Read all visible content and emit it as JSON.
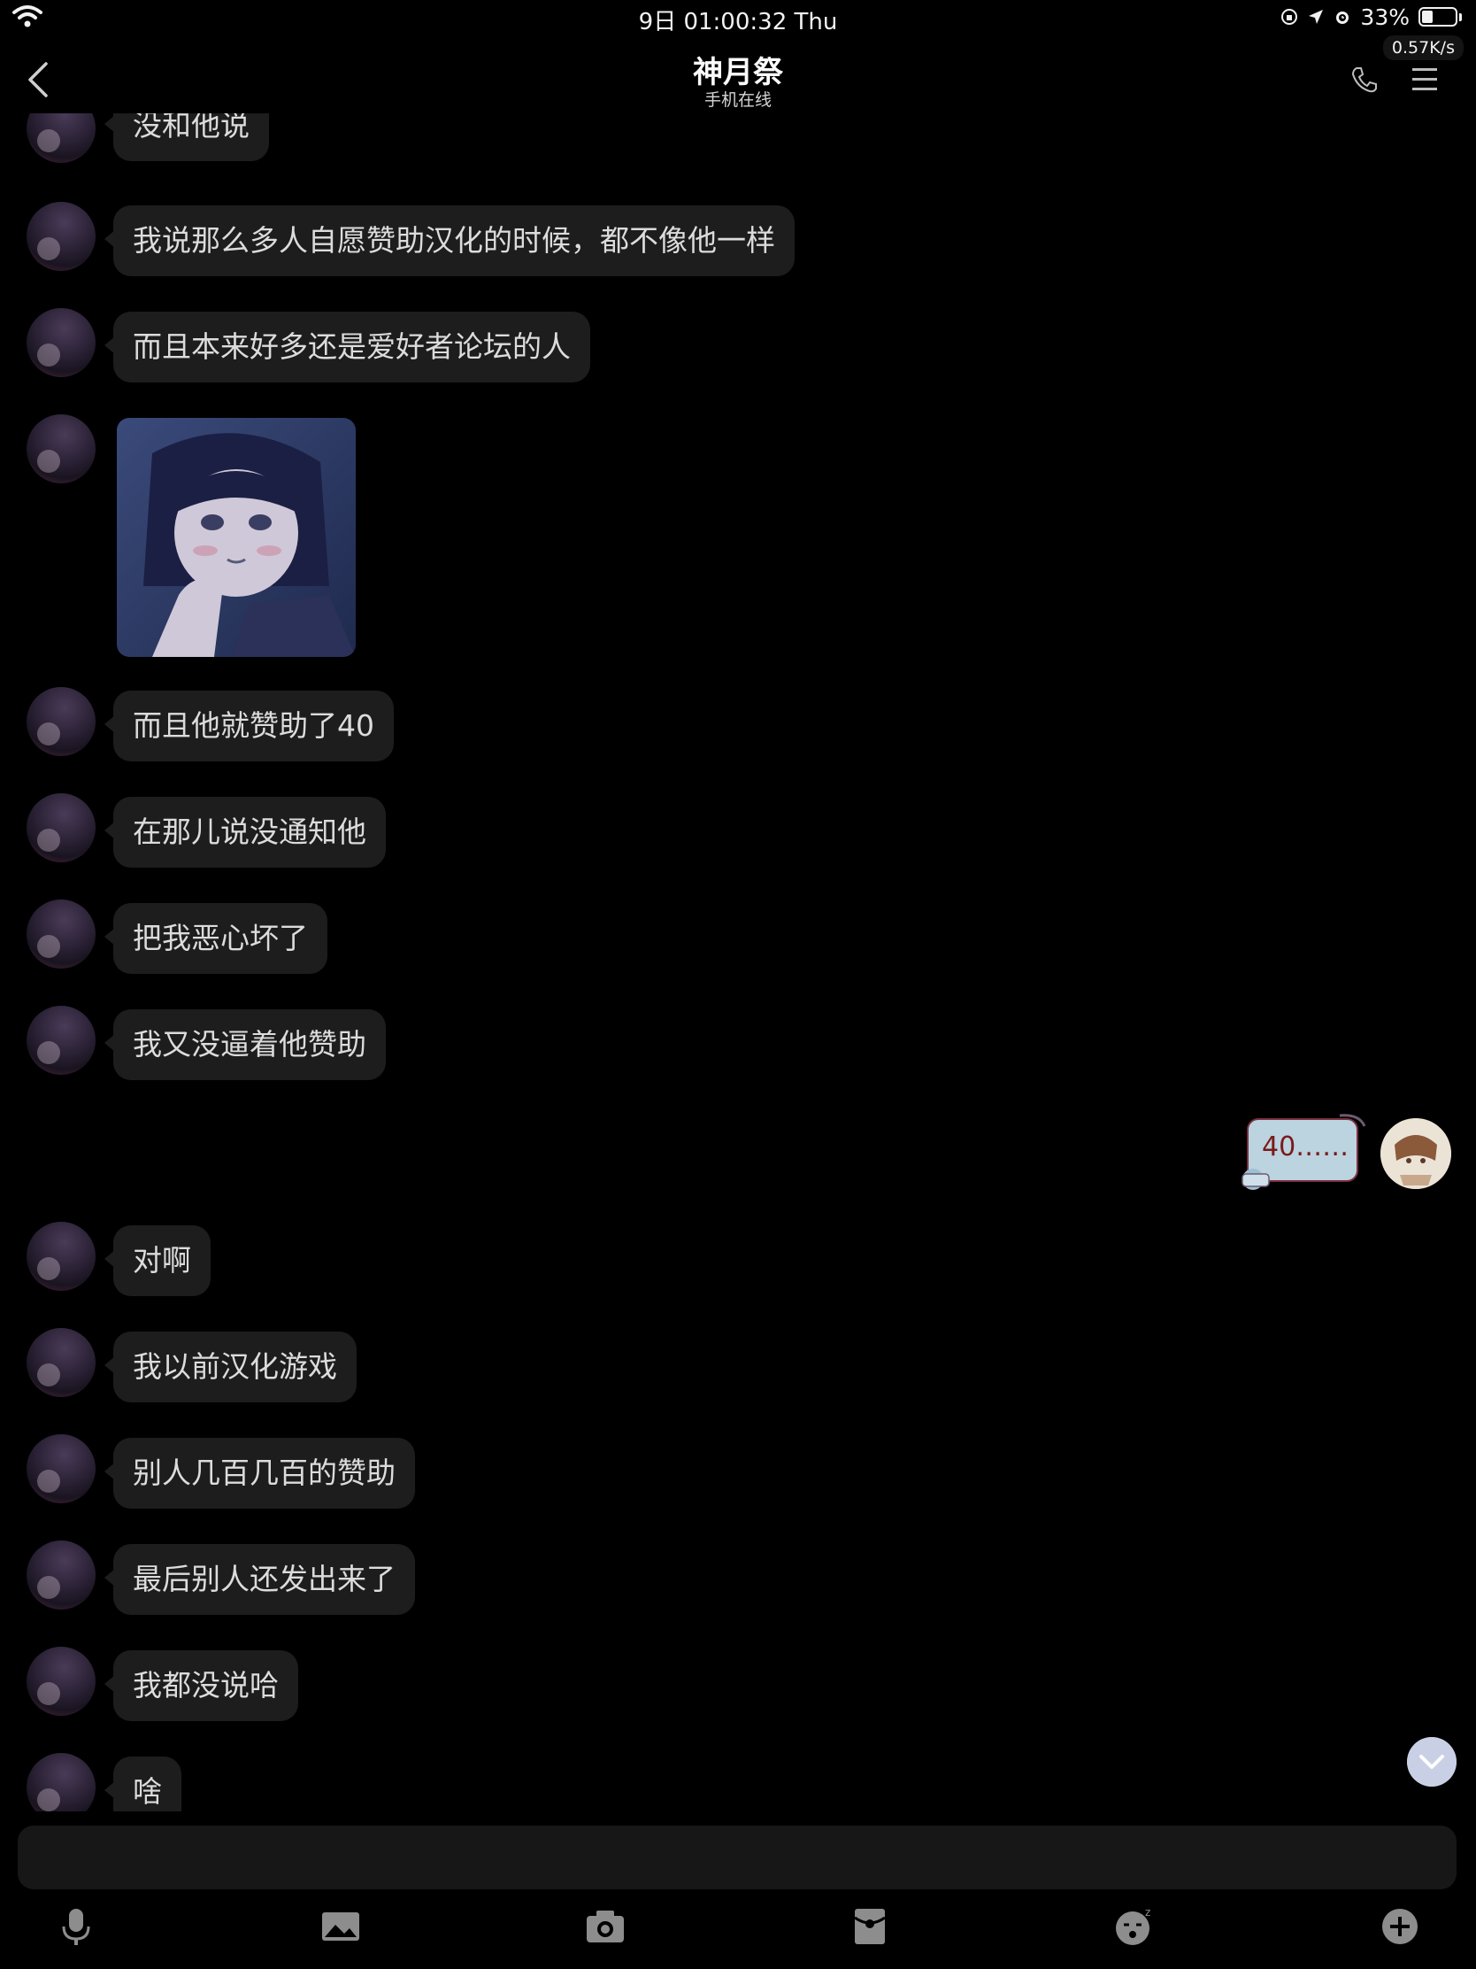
{
  "status_bar": {
    "time": "9日 01:00:32 Thu",
    "battery_percent": "33%",
    "battery_level": 0.33,
    "net_speed": "0.57K/s"
  },
  "header": {
    "title": "神月祭",
    "subtitle": "手机在线"
  },
  "messages": [
    {
      "from": "other",
      "type": "text",
      "text": "没和他说"
    },
    {
      "from": "other",
      "type": "text",
      "text": "我说那么多人自愿赞助汉化的时候，都不像他一样"
    },
    {
      "from": "other",
      "type": "text",
      "text": "而且本来好多还是爱好者论坛的人"
    },
    {
      "from": "other",
      "type": "image"
    },
    {
      "from": "other",
      "type": "text",
      "text": "而且他就赞助了40"
    },
    {
      "from": "other",
      "type": "text",
      "text": "在那儿说没通知他"
    },
    {
      "from": "other",
      "type": "text",
      "text": "把我恶心坏了"
    },
    {
      "from": "other",
      "type": "text",
      "text": "我又没逼着他赞助"
    },
    {
      "from": "me",
      "type": "sticker",
      "text": "40……"
    },
    {
      "from": "other",
      "type": "text",
      "text": "对啊"
    },
    {
      "from": "other",
      "type": "text",
      "text": "我以前汉化游戏"
    },
    {
      "from": "other",
      "type": "text",
      "text": "别人几百几百的赞助"
    },
    {
      "from": "other",
      "type": "text",
      "text": "最后别人还发出来了"
    },
    {
      "from": "other",
      "type": "text",
      "text": "我都没说哈"
    },
    {
      "from": "other",
      "type": "text",
      "text": "啥"
    }
  ],
  "input": {
    "value": "",
    "placeholder": ""
  },
  "toolbar": {
    "icons": [
      "microphone-icon",
      "image-icon",
      "camera-icon",
      "red-packet-icon",
      "emoji-icon",
      "plus-icon"
    ]
  },
  "colors": {
    "background": "#000000",
    "bubble": "#1d1d1d",
    "text": "#dcdcdc",
    "scroll_button": "#c9d0e6"
  }
}
